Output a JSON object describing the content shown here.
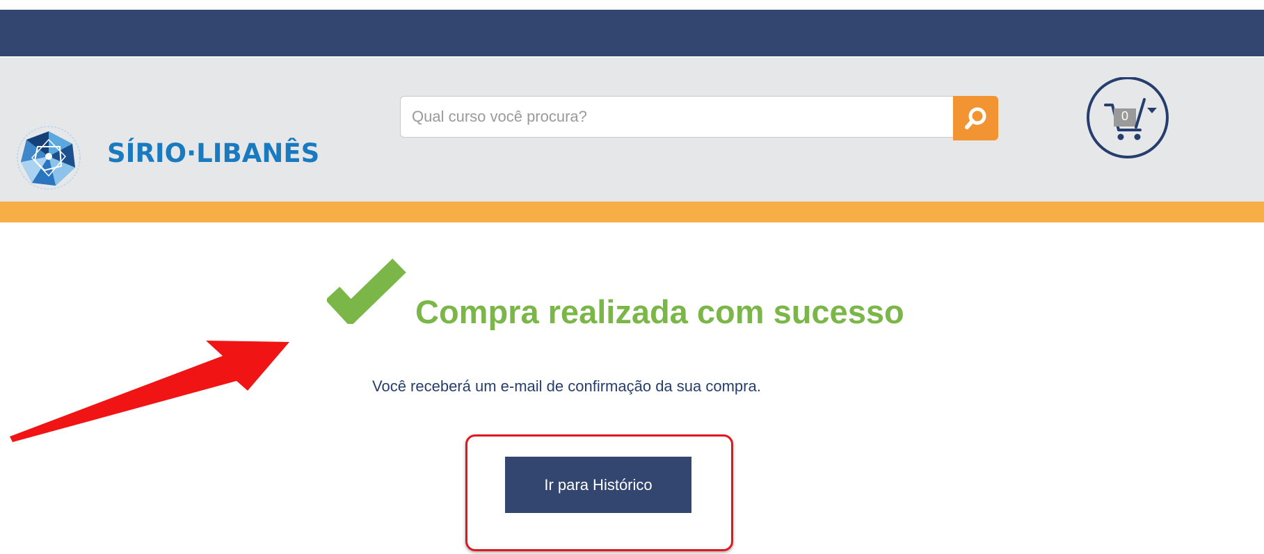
{
  "brand": {
    "name": "SÍRIO·LIBANÊS",
    "color": "#1a7ac0"
  },
  "search": {
    "placeholder": "Qual curso você procura?",
    "button_icon": "search-icon"
  },
  "cart": {
    "count": "0",
    "icon": "cart-icon"
  },
  "confirmation": {
    "title": "Compra realizada com sucesso",
    "message": "Você receberá um e-mail de confirmação da sua compra.",
    "icon": "checkmark-icon"
  },
  "actions": {
    "history_label": "Ir para Histórico"
  },
  "colors": {
    "top_bar": "#32466f",
    "header_bg": "#e6e7e9",
    "accent_stripe": "#f8ae47",
    "search_button": "#f39432",
    "success_green": "#7ab648",
    "text_navy": "#263e6e",
    "annotation_red": "#e0181e"
  }
}
